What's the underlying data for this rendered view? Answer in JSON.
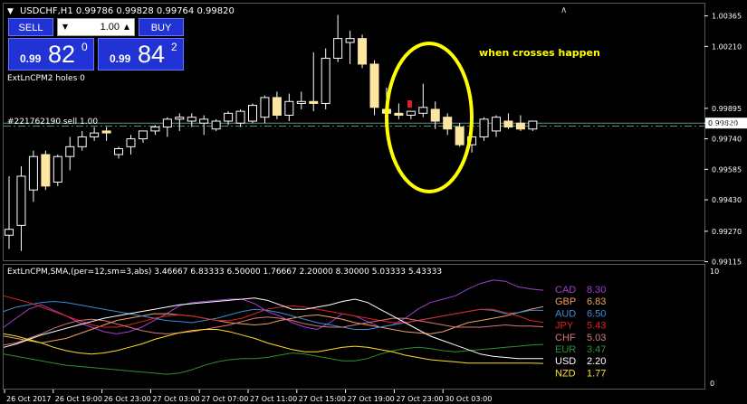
{
  "header": {
    "symbol_info": "USDCHF,H1  0.99786 0.99828 0.99764 0.99820"
  },
  "one_click": {
    "sell_label": "SELL",
    "buy_label": "BUY",
    "lot": "1.00",
    "sell_price_small": "0.99",
    "sell_price_big": "82",
    "sell_price_sup": "0",
    "buy_price_small": "0.99",
    "buy_price_big": "84",
    "buy_price_sup": "2"
  },
  "indicator_caption": "ExtLnCPM2 holes 0",
  "order_line_label": "#221762190 sell 1.00",
  "annotation": "when crosses happen",
  "lower_title": "ExtLnCPM,SMA,(per=12,sm=3,abs) 3.46667 6.83333 6.50000 1.76667 2.20000 8.30000 5.03333 5.43333",
  "colors": {
    "bull": "#ffffff",
    "bear": "#fde6a0",
    "wick": "#ffffff",
    "grid": "#5a5a5a",
    "axis_text": "#ffffff",
    "bid_line": "#6f8aa0",
    "order_line": "#3aa03a",
    "annotation": "#ffff00"
  },
  "chart_data": [
    {
      "type": "candlestick",
      "symbol": "USDCHF",
      "timeframe": "H1",
      "ylim": [
        0.9915,
        1.004
      ],
      "yticks": [
        "1.00365",
        "1.00210",
        "0.99895",
        "0.99820",
        "0.99740",
        "0.99585",
        "0.99430",
        "0.99270",
        "0.99115"
      ],
      "ytick_values": [
        1.00365,
        1.0021,
        0.99895,
        0.9982,
        0.9974,
        0.99585,
        0.9943,
        0.9927,
        0.99115
      ],
      "current_price": 0.9982,
      "order_line_price": 0.99805,
      "xticks": [
        "26 Oct 2017",
        "26 Oct 19:00",
        "26 Oct 23:00",
        "27 Oct 03:00",
        "27 Oct 07:00",
        "27 Oct 11:00",
        "27 Oct 15:00",
        "27 Oct 19:00",
        "27 Oct 23:00",
        "30 Oct 03:00"
      ],
      "xtick_bar_index": [
        0,
        4,
        8,
        12,
        16,
        20,
        24,
        28,
        32,
        36
      ],
      "candles": [
        {
          "o": 0.9925,
          "h": 0.9955,
          "l": 0.9918,
          "c": 0.9928
        },
        {
          "o": 0.993,
          "h": 0.996,
          "l": 0.9917,
          "c": 0.9955
        },
        {
          "o": 0.9948,
          "h": 0.9968,
          "l": 0.9942,
          "c": 0.9965
        },
        {
          "o": 0.9966,
          "h": 0.9968,
          "l": 0.9948,
          "c": 0.995
        },
        {
          "o": 0.9952,
          "h": 0.9966,
          "l": 0.995,
          "c": 0.9965
        },
        {
          "o": 0.9965,
          "h": 0.9975,
          "l": 0.9958,
          "c": 0.997
        },
        {
          "o": 0.997,
          "h": 0.9978,
          "l": 0.9968,
          "c": 0.9975
        },
        {
          "o": 0.9975,
          "h": 0.998,
          "l": 0.9973,
          "c": 0.9977
        },
        {
          "o": 0.9978,
          "h": 0.998,
          "l": 0.9973,
          "c": 0.9977
        },
        {
          "o": 0.9966,
          "h": 0.997,
          "l": 0.9964,
          "c": 0.9969
        },
        {
          "o": 0.997,
          "h": 0.9976,
          "l": 0.9966,
          "c": 0.9974
        },
        {
          "o": 0.9974,
          "h": 0.9978,
          "l": 0.9972,
          "c": 0.9978
        },
        {
          "o": 0.9978,
          "h": 0.9981,
          "l": 0.9976,
          "c": 0.998
        },
        {
          "o": 0.998,
          "h": 0.9985,
          "l": 0.9975,
          "c": 0.9984
        },
        {
          "o": 0.9984,
          "h": 0.9987,
          "l": 0.9978,
          "c": 0.9985
        },
        {
          "o": 0.9983,
          "h": 0.9987,
          "l": 0.998,
          "c": 0.9985
        },
        {
          "o": 0.9982,
          "h": 0.9986,
          "l": 0.9976,
          "c": 0.9984
        },
        {
          "o": 0.9979,
          "h": 0.9984,
          "l": 0.9978,
          "c": 0.9983
        },
        {
          "o": 0.9983,
          "h": 0.9988,
          "l": 0.9981,
          "c": 0.9987
        },
        {
          "o": 0.9982,
          "h": 0.9989,
          "l": 0.998,
          "c": 0.9988
        },
        {
          "o": 0.9983,
          "h": 0.9992,
          "l": 0.9982,
          "c": 0.9991
        },
        {
          "o": 0.9985,
          "h": 0.9996,
          "l": 0.9982,
          "c": 0.9995
        },
        {
          "o": 0.9995,
          "h": 0.9998,
          "l": 0.9984,
          "c": 0.9986
        },
        {
          "o": 0.9986,
          "h": 0.9997,
          "l": 0.9983,
          "c": 0.9993
        },
        {
          "o": 0.9992,
          "h": 0.9998,
          "l": 0.9989,
          "c": 0.9993
        },
        {
          "o": 0.9993,
          "h": 1.0018,
          "l": 0.9988,
          "c": 0.9992
        },
        {
          "o": 0.9992,
          "h": 1.002,
          "l": 0.9989,
          "c": 1.0015
        },
        {
          "o": 1.0015,
          "h": 1.0037,
          "l": 1.0013,
          "c": 1.0025
        },
        {
          "o": 1.0023,
          "h": 1.0029,
          "l": 1.0012,
          "c": 1.0025
        },
        {
          "o": 1.0025,
          "h": 1.0027,
          "l": 1.001,
          "c": 1.0012
        },
        {
          "o": 1.0012,
          "h": 1.0014,
          "l": 0.9986,
          "c": 0.999
        },
        {
          "o": 0.9989,
          "h": 1.0,
          "l": 0.998,
          "c": 0.9987
        },
        {
          "o": 0.9987,
          "h": 0.9992,
          "l": 0.9984,
          "c": 0.9986
        },
        {
          "o": 0.9986,
          "h": 0.9988,
          "l": 0.9984,
          "c": 0.9988
        },
        {
          "o": 0.9987,
          "h": 1.0002,
          "l": 0.9985,
          "c": 0.999
        },
        {
          "o": 0.9989,
          "h": 0.9993,
          "l": 0.9979,
          "c": 0.9983
        },
        {
          "o": 0.9985,
          "h": 0.9987,
          "l": 0.9976,
          "c": 0.9979
        },
        {
          "o": 0.998,
          "h": 0.9982,
          "l": 0.997,
          "c": 0.9971
        },
        {
          "o": 0.9971,
          "h": 0.9979,
          "l": 0.9967,
          "c": 0.9975
        },
        {
          "o": 0.9975,
          "h": 0.9985,
          "l": 0.9973,
          "c": 0.9984
        },
        {
          "o": 0.9978,
          "h": 0.9986,
          "l": 0.9975,
          "c": 0.9985
        },
        {
          "o": 0.9983,
          "h": 0.9987,
          "l": 0.9979,
          "c": 0.998
        },
        {
          "o": 0.9982,
          "h": 0.9986,
          "l": 0.9978,
          "c": 0.9979
        },
        {
          "o": 0.9979,
          "h": 0.9983,
          "l": 0.9978,
          "c": 0.9983
        }
      ]
    },
    {
      "type": "line",
      "title": "ExtLnCPM,SMA,(per=12,sm=3,abs) 3.46667 6.83333 6.50000 1.76667 2.20000 8.30000 5.03333 5.43333",
      "ylim": [
        0,
        10
      ],
      "yticks": [
        "10",
        "0"
      ],
      "ytick_values": [
        10,
        0
      ],
      "series": [
        {
          "name": "CAD",
          "label": "8.30",
          "color": "#a040d0",
          "values": [
            5.0,
            5.8,
            6.6,
            7.0,
            6.5,
            6.0,
            5.4,
            5.0,
            4.6,
            4.4,
            4.6,
            5.0,
            5.6,
            6.2,
            6.9,
            7.2,
            7.3,
            7.4,
            7.5,
            7.5,
            7.1,
            6.4,
            6.0,
            5.4,
            5.0,
            4.8,
            5.4,
            6.2,
            6.0,
            5.5,
            5.0,
            5.2,
            5.8,
            6.6,
            7.2,
            7.5,
            7.8,
            8.4,
            8.9,
            9.2,
            9.1,
            8.6,
            8.4,
            8.3
          ]
        },
        {
          "name": "GBP",
          "label": "6.83",
          "color": "#f0a060",
          "values": [
            4.2,
            4.0,
            3.8,
            3.6,
            3.8,
            4.0,
            4.4,
            4.8,
            5.2,
            5.6,
            5.8,
            6.0,
            6.2,
            6.2,
            6.1,
            6.0,
            5.8,
            5.6,
            5.4,
            5.3,
            5.2,
            5.3,
            5.6,
            5.8,
            6.0,
            6.1,
            5.9,
            5.7,
            5.4,
            5.2,
            5.0,
            4.8,
            4.6,
            4.5,
            4.4,
            4.6,
            5.0,
            5.4,
            5.6,
            5.8,
            6.0,
            6.3,
            6.6,
            6.83
          ]
        },
        {
          "name": "AUD",
          "label": "6.50",
          "color": "#3a8ed8",
          "values": [
            6.4,
            6.8,
            7.0,
            7.2,
            7.3,
            7.2,
            7.0,
            6.8,
            6.6,
            6.4,
            6.2,
            6.0,
            5.8,
            5.6,
            5.5,
            5.4,
            5.6,
            5.8,
            6.1,
            6.4,
            6.6,
            6.5,
            6.3,
            6.0,
            5.7,
            5.4,
            5.2,
            5.0,
            4.8,
            4.8,
            5.0,
            5.2,
            5.4,
            5.6,
            5.8,
            6.0,
            6.2,
            6.4,
            6.6,
            6.5,
            6.2,
            6.3,
            6.5,
            6.5
          ]
        },
        {
          "name": "JPY",
          "label": "5.43",
          "color": "#e02020",
          "values": [
            7.8,
            7.5,
            7.2,
            6.8,
            6.4,
            6.0,
            5.6,
            5.2,
            5.0,
            5.0,
            5.2,
            5.5,
            5.8,
            6.0,
            6.1,
            6.0,
            5.8,
            5.6,
            5.6,
            5.8,
            6.2,
            6.6,
            6.8,
            6.9,
            6.8,
            6.6,
            6.4,
            6.2,
            6.0,
            5.8,
            5.6,
            5.4,
            5.4,
            5.6,
            5.8,
            6.0,
            6.2,
            6.4,
            6.6,
            6.6,
            6.3,
            6.0,
            5.6,
            5.43
          ]
        },
        {
          "name": "CHF",
          "label": "5.03",
          "color": "#d87878",
          "values": [
            3.4,
            3.6,
            4.0,
            4.4,
            4.9,
            5.3,
            5.6,
            5.7,
            5.6,
            5.3,
            5.0,
            4.7,
            4.5,
            4.4,
            4.5,
            4.6,
            4.8,
            5.0,
            5.2,
            5.5,
            5.8,
            5.9,
            5.8,
            5.6,
            5.3,
            5.1,
            5.0,
            5.0,
            5.2,
            5.4,
            5.6,
            5.8,
            5.8,
            5.6,
            5.4,
            5.2,
            5.0,
            5.0,
            5.0,
            5.1,
            5.2,
            5.1,
            5.1,
            5.03
          ]
        },
        {
          "name": "EUR",
          "label": "3.47",
          "color": "#2f8f2f",
          "values": [
            2.6,
            2.4,
            2.2,
            2.0,
            1.8,
            1.6,
            1.5,
            1.4,
            1.3,
            1.2,
            1.1,
            1.0,
            0.9,
            0.8,
            0.9,
            1.2,
            1.6,
            1.9,
            2.1,
            2.2,
            2.2,
            2.3,
            2.5,
            2.7,
            2.6,
            2.4,
            2.2,
            2.0,
            2.0,
            2.2,
            2.6,
            2.9,
            3.1,
            3.2,
            3.1,
            2.9,
            2.8,
            2.9,
            3.0,
            3.1,
            3.2,
            3.3,
            3.4,
            3.47
          ]
        },
        {
          "name": "USD",
          "label": "2.20",
          "color": "#ffffff",
          "values": [
            3.2,
            3.5,
            3.9,
            4.3,
            4.6,
            4.9,
            5.2,
            5.5,
            5.8,
            6.0,
            6.2,
            6.4,
            6.6,
            6.8,
            7.0,
            7.1,
            7.2,
            7.3,
            7.4,
            7.5,
            7.6,
            7.4,
            7.0,
            6.6,
            6.6,
            6.8,
            7.0,
            7.3,
            7.5,
            7.2,
            6.6,
            6.0,
            5.4,
            4.8,
            4.2,
            3.8,
            3.4,
            3.0,
            2.6,
            2.4,
            2.3,
            2.2,
            2.2,
            2.2
          ]
        },
        {
          "name": "NZD",
          "label": "1.77",
          "color": "#ffe020",
          "values": [
            4.4,
            4.2,
            3.9,
            3.6,
            3.2,
            2.9,
            2.7,
            2.6,
            2.7,
            2.9,
            3.2,
            3.5,
            3.9,
            4.2,
            4.5,
            4.7,
            4.8,
            4.8,
            4.6,
            4.3,
            4.0,
            3.6,
            3.3,
            3.0,
            2.8,
            2.8,
            3.0,
            3.2,
            3.3,
            3.2,
            3.0,
            2.8,
            2.5,
            2.3,
            2.1,
            2.0,
            1.9,
            1.8,
            1.8,
            1.8,
            1.8,
            1.8,
            1.8,
            1.77
          ]
        }
      ]
    }
  ]
}
